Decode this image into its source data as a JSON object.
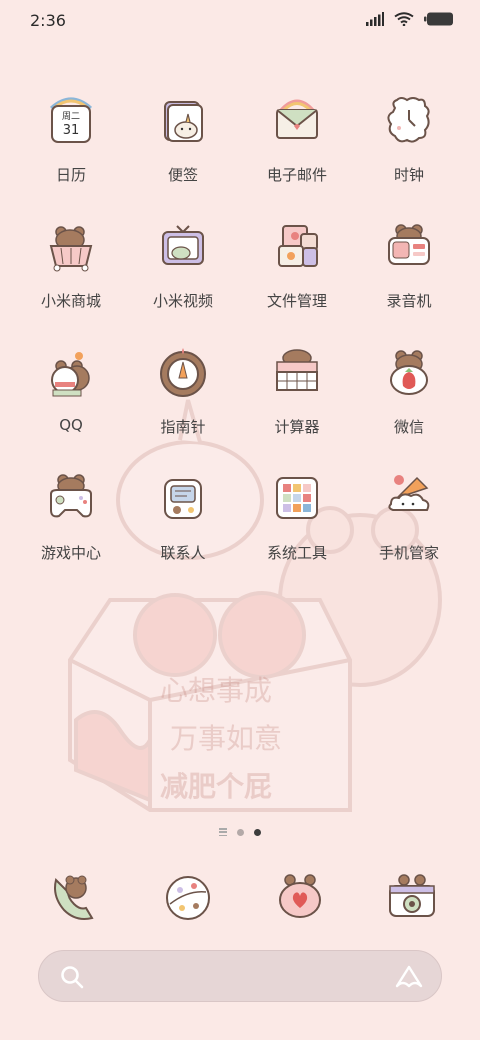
{
  "status_bar": {
    "time": "2:36",
    "icons": [
      "signal-icon",
      "wifi-icon",
      "battery-icon"
    ]
  },
  "wallpaper": {
    "text_lines": [
      "心想事成",
      "万事如意",
      "减肥个屁"
    ]
  },
  "apps": [
    {
      "label": "日历",
      "icon": "calendar-icon",
      "icon_text": "周二",
      "icon_num": "31"
    },
    {
      "label": "便签",
      "icon": "notes-icon"
    },
    {
      "label": "电子邮件",
      "icon": "email-icon"
    },
    {
      "label": "时钟",
      "icon": "clock-icon"
    },
    {
      "label": "小米商城",
      "icon": "mi-store-icon"
    },
    {
      "label": "小米视频",
      "icon": "mi-video-icon"
    },
    {
      "label": "文件管理",
      "icon": "file-manager-icon"
    },
    {
      "label": "录音机",
      "icon": "recorder-icon"
    },
    {
      "label": "QQ",
      "icon": "qq-icon"
    },
    {
      "label": "指南针",
      "icon": "compass-icon"
    },
    {
      "label": "计算器",
      "icon": "calculator-icon"
    },
    {
      "label": "微信",
      "icon": "wechat-icon"
    },
    {
      "label": "游戏中心",
      "icon": "game-center-icon"
    },
    {
      "label": "联系人",
      "icon": "contacts-icon"
    },
    {
      "label": "系统工具",
      "icon": "system-tools-icon"
    },
    {
      "label": "手机管家",
      "icon": "security-icon"
    }
  ],
  "pager": {
    "pages": 2,
    "active": 2
  },
  "dock": [
    "phone-icon",
    "browser-icon",
    "messages-icon",
    "camera-icon"
  ],
  "search_bar": {
    "left_icon": "search-icon",
    "right_icon": "assistant-icon"
  },
  "colors": {
    "background": "#fbe9e6",
    "accent_brown": "#a57b5f",
    "accent_pink": "#e8827f",
    "line": "#6b5349"
  }
}
